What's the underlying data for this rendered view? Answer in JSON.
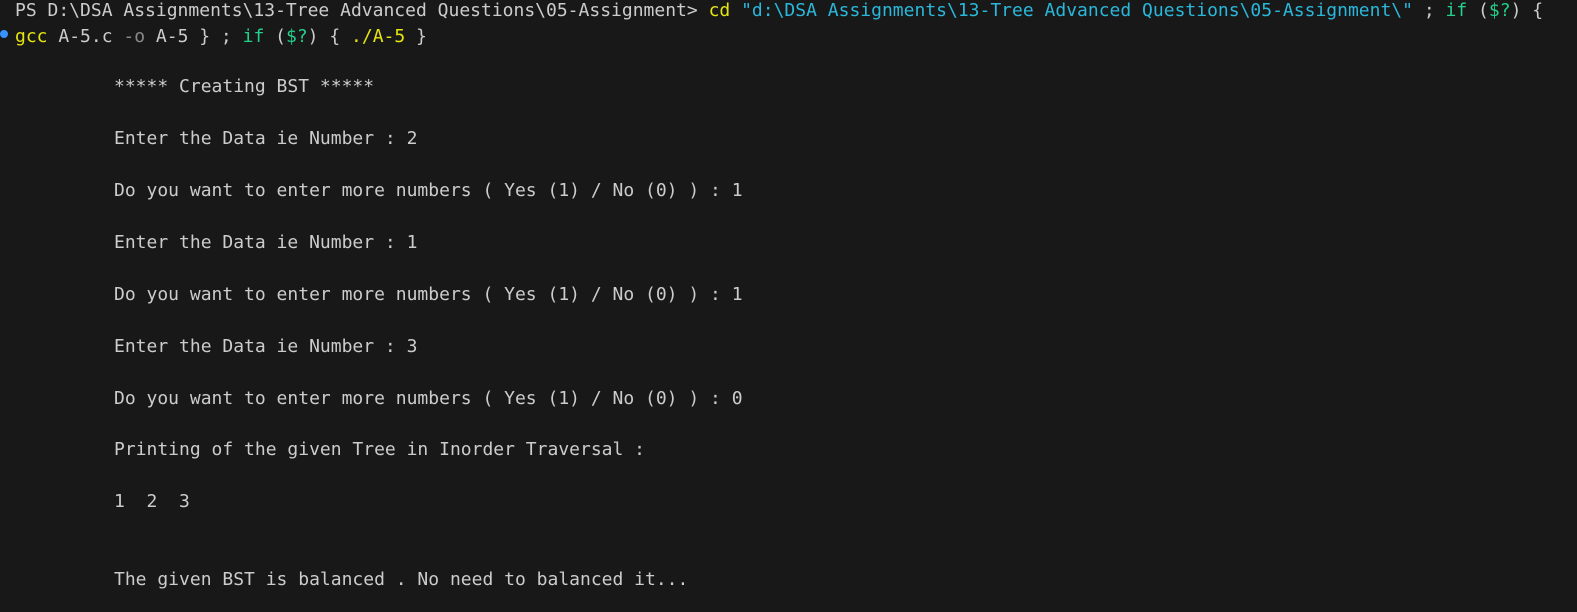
{
  "prompt": {
    "prefix": "PS D:\\DSA Assignments\\13-Tree Advanced Questions\\05-Assignment> ",
    "cd_cmd": "cd",
    "cd_path": " \"d:\\DSA Assignments\\13-Tree Advanced Questions\\05-Assignment\\\"",
    "sep1": " ; ",
    "if1": "if",
    "cond1_open": " (",
    "cond1_var": "$?",
    "cond1_close": ") {",
    "gcc_cmd": "gcc",
    "gcc_args1": " A-5.c ",
    "gcc_flag": "-o",
    "gcc_args2": " A-5 } ; ",
    "if2": "if",
    "cond2_open": " (",
    "cond2_var": "$?",
    "cond2_close": ") { ",
    "run_cmd": "./A-5",
    "run_close": " }"
  },
  "output": [
    "***** Creating BST *****",
    "Enter the Data ie Number : 2",
    "Do you want to enter more numbers ( Yes (1) / No (0) ) : 1",
    "Enter the Data ie Number : 1",
    "Do you want to enter more numbers ( Yes (1) / No (0) ) : 1",
    "Enter the Data ie Number : 3",
    "Do you want to enter more numbers ( Yes (1) / No (0) ) : 0",
    "Printing of the given Tree in Inorder Traversal :",
    "1  2  3",
    "The given BST is balanced . No need to balanced it..."
  ],
  "colors": {
    "background": "#181818",
    "text": "#cccccc",
    "command": "#e5e510",
    "string": "#29b8db",
    "keyword": "#23d18b",
    "flag": "#8a8a8a",
    "decoration": "#3794ff"
  }
}
